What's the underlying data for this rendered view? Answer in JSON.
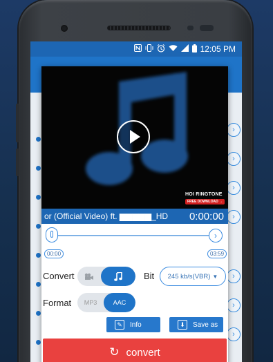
{
  "status_bar": {
    "icons": [
      "nfc-icon",
      "vibrate-icon",
      "alarm-icon",
      "wifi-icon",
      "signal-icon",
      "battery-icon"
    ],
    "time": "12:05 PM"
  },
  "video": {
    "title": "or (Official Video) ft. ▆▆▆▆▆_HD",
    "time": "0:00:00",
    "watermark": "HOI RINGTONE",
    "watermark_badge": "FREE DOWNLOAD →"
  },
  "trim": {
    "start": "00:00",
    "end": "03:59"
  },
  "convert_row": {
    "label": "Convert",
    "options": [
      "video-icon",
      "music-icon"
    ],
    "selected": "music-icon"
  },
  "bit": {
    "label": "Bit",
    "value": "245 kb/s(VBR)"
  },
  "format_row": {
    "label": "Format",
    "options": [
      "MP3",
      "AAC"
    ],
    "selected": "AAC"
  },
  "actions": {
    "info": "Info",
    "save_as": "Save as",
    "convert": "convert"
  },
  "colors": {
    "primary": "#1f74c8",
    "accent_red": "#e9413f"
  }
}
